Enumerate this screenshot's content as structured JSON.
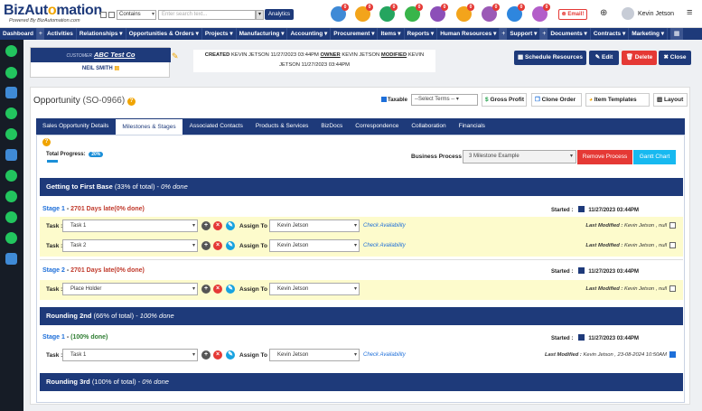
{
  "app": {
    "logo_main": "BizAut",
    "logo_o": "o",
    "logo_rest": "mation",
    "logo_sub": "Powered By BizAutomation.com"
  },
  "search": {
    "filter": "Contains",
    "placeholder": "Enter search text...",
    "analytics_label": "Analytics"
  },
  "top_icons": [
    {
      "icon": "pie-icon",
      "color": "#3f8ad6",
      "badge": "0"
    },
    {
      "icon": "dollar-icon",
      "color": "#f3a41b",
      "badge": "0"
    },
    {
      "icon": "handshake-icon",
      "color": "#25a55f",
      "badge": "0"
    },
    {
      "icon": "cart-icon",
      "color": "#39b54a",
      "badge": "0"
    },
    {
      "icon": "box-icon",
      "color": "#8c4fb8",
      "badge": "0"
    },
    {
      "icon": "mail-icon",
      "color": "#f3a41b",
      "badge": "0"
    },
    {
      "icon": "calendar-icon",
      "color": "#9b59b6",
      "badge": "0"
    },
    {
      "icon": "users-icon",
      "color": "#2e86de",
      "badge": "0"
    },
    {
      "icon": "document-icon",
      "color": "#b35ec9",
      "badge": "0"
    }
  ],
  "email_label": "Email!",
  "user": {
    "name": "Kevin Jetson"
  },
  "nav": [
    {
      "label": "Dashboard",
      "plus": true
    },
    {
      "label": "Activities"
    },
    {
      "label": "Relationships"
    },
    {
      "label": "Opportunities & Orders"
    },
    {
      "label": "Projects"
    },
    {
      "label": "Manufacturing"
    },
    {
      "label": "Accounting"
    },
    {
      "label": "Procurement"
    },
    {
      "label": "Items"
    },
    {
      "label": "Reports"
    },
    {
      "label": "Human Resources",
      "plus": true
    },
    {
      "label": "Support",
      "plus": true
    },
    {
      "label": "Documents"
    },
    {
      "label": "Contracts"
    },
    {
      "label": "Marketing"
    }
  ],
  "customer": {
    "label": "CUSTOMER",
    "name": "ABC Test Co",
    "contact": "NEIL SMITH"
  },
  "meta": {
    "created_label": "CREATED",
    "created": "KEVIN JETSON 11/27/2023 03:44PM",
    "owner_label": "OWNER",
    "owner": "KEVIN JETSON",
    "modified_label": "MODIFIED",
    "modified": "KEVIN JETSON 11/27/2023 03:44PM"
  },
  "header_buttons": {
    "schedule": "Schedule Resources",
    "edit": "Edit",
    "delete": "Delete",
    "close": "Close"
  },
  "opportunity": {
    "title": "Opportunity",
    "id": "(SO-0966)"
  },
  "toolbar": {
    "taxable": "Taxable",
    "terms": "--Select Terms --",
    "gross_profit": "Gross Profit",
    "clone_order": "Clone Order",
    "item_templates": "Item Templates",
    "layout": "Layout"
  },
  "tabs": [
    "Sales Opportunity Details",
    "Milestones & Stages",
    "Associated Contacts",
    "Products & Services",
    "BizDocs",
    "Correspondence",
    "Collaboration",
    "Financials"
  ],
  "progress": {
    "label": "Total Progress:",
    "value": "20%",
    "percent": 20
  },
  "business_process": {
    "label": "Business Process :",
    "value": "3 Milestone Example",
    "remove": "Remove Process",
    "gantt": "Gantt Chart"
  },
  "labels": {
    "task": "Task :",
    "assign": "Assign To :",
    "check": "Check Availability",
    "started": "Started :",
    "last_modified": "Last Modified :"
  },
  "milestones": [
    {
      "name": "Getting to First Base",
      "pct": "(33% of total)",
      "done": "0% done"
    },
    {
      "name": "Rounding 2nd",
      "pct": "(66% of total)",
      "done": "100% done"
    },
    {
      "name": "Rounding 3rd",
      "pct": "(100% of total)",
      "done": "0% done"
    }
  ],
  "stages": [
    {
      "name": "Stage 1",
      "status": "2701 Days late(0% done)",
      "started": "11/27/2023 03:44PM"
    },
    {
      "name": "Stage 2",
      "status": "2701 Days late(0% done)",
      "started": "11/27/2023 03:44PM"
    },
    {
      "name": "Stage 1",
      "status": "(100% done)",
      "started": "11/27/2023 03:44PM"
    }
  ],
  "tasks": [
    {
      "name": "Task 1",
      "assignee": "Kevin Jetson",
      "modified": "Kevin Jetson , null",
      "checked": false
    },
    {
      "name": "Task 2",
      "assignee": "Kevin Jetson",
      "modified": "Kevin Jetson , null",
      "checked": false
    },
    {
      "name": "Place Holder",
      "assignee": "Kevin Jetson",
      "modified": "Kevin Jetson , null",
      "checked": false
    },
    {
      "name": "Task 1",
      "assignee": "Kevin Jetson",
      "modified": "Kevin Jetson , 23-08-2024 10:50AM",
      "checked": true
    }
  ],
  "sidebar_icons": [
    "eye-icon",
    "cart-icon",
    "cylinder-icon",
    "cart-icon",
    "cart-icon",
    "cylinder-icon",
    "cart-icon",
    "cart-icon",
    "cart-icon",
    "cart-icon",
    "cylinder-icon"
  ]
}
